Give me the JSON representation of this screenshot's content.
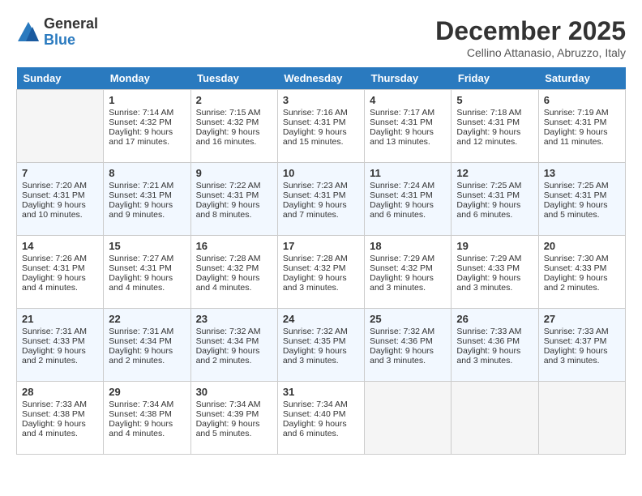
{
  "logo": {
    "general": "General",
    "blue": "Blue"
  },
  "title": "December 2025",
  "location": "Cellino Attanasio, Abruzzo, Italy",
  "days_header": [
    "Sunday",
    "Monday",
    "Tuesday",
    "Wednesday",
    "Thursday",
    "Friday",
    "Saturday"
  ],
  "weeks": [
    [
      {
        "day": "",
        "sunrise": "",
        "sunset": "",
        "daylight": ""
      },
      {
        "day": "1",
        "sunrise": "Sunrise: 7:14 AM",
        "sunset": "Sunset: 4:32 PM",
        "daylight": "Daylight: 9 hours and 17 minutes."
      },
      {
        "day": "2",
        "sunrise": "Sunrise: 7:15 AM",
        "sunset": "Sunset: 4:32 PM",
        "daylight": "Daylight: 9 hours and 16 minutes."
      },
      {
        "day": "3",
        "sunrise": "Sunrise: 7:16 AM",
        "sunset": "Sunset: 4:31 PM",
        "daylight": "Daylight: 9 hours and 15 minutes."
      },
      {
        "day": "4",
        "sunrise": "Sunrise: 7:17 AM",
        "sunset": "Sunset: 4:31 PM",
        "daylight": "Daylight: 9 hours and 13 minutes."
      },
      {
        "day": "5",
        "sunrise": "Sunrise: 7:18 AM",
        "sunset": "Sunset: 4:31 PM",
        "daylight": "Daylight: 9 hours and 12 minutes."
      },
      {
        "day": "6",
        "sunrise": "Sunrise: 7:19 AM",
        "sunset": "Sunset: 4:31 PM",
        "daylight": "Daylight: 9 hours and 11 minutes."
      }
    ],
    [
      {
        "day": "7",
        "sunrise": "Sunrise: 7:20 AM",
        "sunset": "Sunset: 4:31 PM",
        "daylight": "Daylight: 9 hours and 10 minutes."
      },
      {
        "day": "8",
        "sunrise": "Sunrise: 7:21 AM",
        "sunset": "Sunset: 4:31 PM",
        "daylight": "Daylight: 9 hours and 9 minutes."
      },
      {
        "day": "9",
        "sunrise": "Sunrise: 7:22 AM",
        "sunset": "Sunset: 4:31 PM",
        "daylight": "Daylight: 9 hours and 8 minutes."
      },
      {
        "day": "10",
        "sunrise": "Sunrise: 7:23 AM",
        "sunset": "Sunset: 4:31 PM",
        "daylight": "Daylight: 9 hours and 7 minutes."
      },
      {
        "day": "11",
        "sunrise": "Sunrise: 7:24 AM",
        "sunset": "Sunset: 4:31 PM",
        "daylight": "Daylight: 9 hours and 6 minutes."
      },
      {
        "day": "12",
        "sunrise": "Sunrise: 7:25 AM",
        "sunset": "Sunset: 4:31 PM",
        "daylight": "Daylight: 9 hours and 6 minutes."
      },
      {
        "day": "13",
        "sunrise": "Sunrise: 7:25 AM",
        "sunset": "Sunset: 4:31 PM",
        "daylight": "Daylight: 9 hours and 5 minutes."
      }
    ],
    [
      {
        "day": "14",
        "sunrise": "Sunrise: 7:26 AM",
        "sunset": "Sunset: 4:31 PM",
        "daylight": "Daylight: 9 hours and 4 minutes."
      },
      {
        "day": "15",
        "sunrise": "Sunrise: 7:27 AM",
        "sunset": "Sunset: 4:31 PM",
        "daylight": "Daylight: 9 hours and 4 minutes."
      },
      {
        "day": "16",
        "sunrise": "Sunrise: 7:28 AM",
        "sunset": "Sunset: 4:32 PM",
        "daylight": "Daylight: 9 hours and 4 minutes."
      },
      {
        "day": "17",
        "sunrise": "Sunrise: 7:28 AM",
        "sunset": "Sunset: 4:32 PM",
        "daylight": "Daylight: 9 hours and 3 minutes."
      },
      {
        "day": "18",
        "sunrise": "Sunrise: 7:29 AM",
        "sunset": "Sunset: 4:32 PM",
        "daylight": "Daylight: 9 hours and 3 minutes."
      },
      {
        "day": "19",
        "sunrise": "Sunrise: 7:29 AM",
        "sunset": "Sunset: 4:33 PM",
        "daylight": "Daylight: 9 hours and 3 minutes."
      },
      {
        "day": "20",
        "sunrise": "Sunrise: 7:30 AM",
        "sunset": "Sunset: 4:33 PM",
        "daylight": "Daylight: 9 hours and 2 minutes."
      }
    ],
    [
      {
        "day": "21",
        "sunrise": "Sunrise: 7:31 AM",
        "sunset": "Sunset: 4:33 PM",
        "daylight": "Daylight: 9 hours and 2 minutes."
      },
      {
        "day": "22",
        "sunrise": "Sunrise: 7:31 AM",
        "sunset": "Sunset: 4:34 PM",
        "daylight": "Daylight: 9 hours and 2 minutes."
      },
      {
        "day": "23",
        "sunrise": "Sunrise: 7:32 AM",
        "sunset": "Sunset: 4:34 PM",
        "daylight": "Daylight: 9 hours and 2 minutes."
      },
      {
        "day": "24",
        "sunrise": "Sunrise: 7:32 AM",
        "sunset": "Sunset: 4:35 PM",
        "daylight": "Daylight: 9 hours and 3 minutes."
      },
      {
        "day": "25",
        "sunrise": "Sunrise: 7:32 AM",
        "sunset": "Sunset: 4:36 PM",
        "daylight": "Daylight: 9 hours and 3 minutes."
      },
      {
        "day": "26",
        "sunrise": "Sunrise: 7:33 AM",
        "sunset": "Sunset: 4:36 PM",
        "daylight": "Daylight: 9 hours and 3 minutes."
      },
      {
        "day": "27",
        "sunrise": "Sunrise: 7:33 AM",
        "sunset": "Sunset: 4:37 PM",
        "daylight": "Daylight: 9 hours and 3 minutes."
      }
    ],
    [
      {
        "day": "28",
        "sunrise": "Sunrise: 7:33 AM",
        "sunset": "Sunset: 4:38 PM",
        "daylight": "Daylight: 9 hours and 4 minutes."
      },
      {
        "day": "29",
        "sunrise": "Sunrise: 7:34 AM",
        "sunset": "Sunset: 4:38 PM",
        "daylight": "Daylight: 9 hours and 4 minutes."
      },
      {
        "day": "30",
        "sunrise": "Sunrise: 7:34 AM",
        "sunset": "Sunset: 4:39 PM",
        "daylight": "Daylight: 9 hours and 5 minutes."
      },
      {
        "day": "31",
        "sunrise": "Sunrise: 7:34 AM",
        "sunset": "Sunset: 4:40 PM",
        "daylight": "Daylight: 9 hours and 6 minutes."
      },
      {
        "day": "",
        "sunrise": "",
        "sunset": "",
        "daylight": ""
      },
      {
        "day": "",
        "sunrise": "",
        "sunset": "",
        "daylight": ""
      },
      {
        "day": "",
        "sunrise": "",
        "sunset": "",
        "daylight": ""
      }
    ]
  ]
}
